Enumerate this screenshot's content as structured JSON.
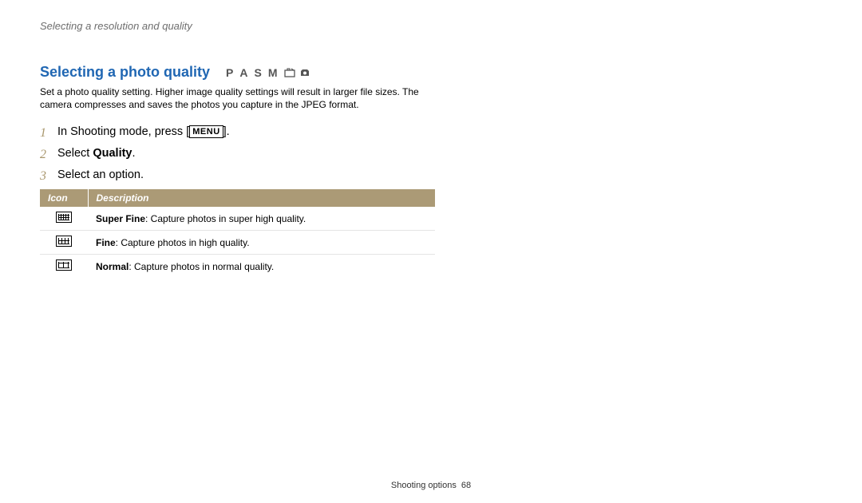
{
  "breadcrumb": "Selecting a resolution and quality",
  "section": {
    "title": "Selecting a photo quality",
    "modes_letters": [
      "P",
      "A",
      "S",
      "M"
    ]
  },
  "intro": "Set a photo quality setting. Higher image quality settings will result in larger file sizes. The camera compresses and saves the photos you capture in the JPEG format.",
  "steps": {
    "s1_prefix": "In Shooting mode, press [",
    "s1_button": "MENU",
    "s1_suffix": "].",
    "s2_prefix": "Select ",
    "s2_bold": "Quality",
    "s2_suffix": ".",
    "s3": "Select an option."
  },
  "table": {
    "head_icon": "Icon",
    "head_desc": "Description",
    "rows": [
      {
        "name": "Super Fine",
        "desc": ": Capture photos in super high quality."
      },
      {
        "name": "Fine",
        "desc": ": Capture photos in high quality."
      },
      {
        "name": "Normal",
        "desc": ": Capture photos in normal quality."
      }
    ]
  },
  "footer": {
    "label": "Shooting options",
    "page": "68"
  }
}
